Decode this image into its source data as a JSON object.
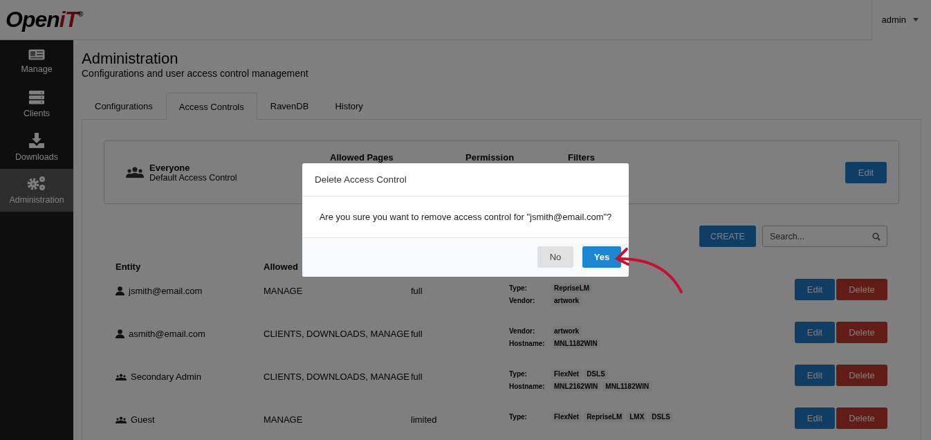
{
  "topbar": {
    "logo": {
      "word": "Open",
      "accent": "iT",
      "mark": "®"
    },
    "user_menu": {
      "label": "admin"
    }
  },
  "sidebar": {
    "items": [
      {
        "kind": "manage",
        "label": "Manage",
        "selected": false
      },
      {
        "kind": "clients",
        "label": "Clients",
        "selected": false
      },
      {
        "kind": "downloads",
        "label": "Downloads",
        "selected": false
      },
      {
        "kind": "admin",
        "label": "Administration",
        "selected": true
      }
    ]
  },
  "page": {
    "title": "Administration",
    "subtitle": "Configurations and user access control management"
  },
  "tabs": [
    {
      "label": "Configurations",
      "selected": false
    },
    {
      "label": "Access Controls",
      "selected": true
    },
    {
      "label": "RavenDB",
      "selected": false
    },
    {
      "label": "History",
      "selected": false
    }
  ],
  "default_card": {
    "name": "Everyone",
    "description": "Default Access Control",
    "columns": [
      "Allowed Pages",
      "Permission",
      "Filters"
    ],
    "edit_button": "Edit"
  },
  "toolbar": {
    "create_button": "CREATE",
    "search": {
      "placeholder": "Search..."
    }
  },
  "table": {
    "columns": [
      "Entity",
      "Allowed"
    ],
    "rows": [
      {
        "kind": "user",
        "entity": "jsmith@email.com",
        "pages": "MANAGE",
        "permission": "full",
        "filters": [
          {
            "label": "Type:",
            "values": [
              "RepriseLM"
            ]
          },
          {
            "label": "Vendor:",
            "values": [
              "artwork"
            ]
          }
        ],
        "edit": "Edit",
        "delete": "Delete"
      },
      {
        "kind": "user",
        "entity": "asmith@email.com",
        "pages": "CLIENTS, DOWNLOADS, MANAGE",
        "permission": "full",
        "filters": [
          {
            "label": "Vendor:",
            "values": [
              "artwork"
            ]
          },
          {
            "label": "Hostname:",
            "values": [
              "MNL1182WIN"
            ]
          }
        ],
        "edit": "Edit",
        "delete": "Delete"
      },
      {
        "kind": "group",
        "entity": "Secondary Admin",
        "pages": "CLIENTS, DOWNLOADS, MANAGE",
        "permission": "full",
        "filters": [
          {
            "label": "Type:",
            "values": [
              "FlexNet",
              "DSLS"
            ]
          },
          {
            "label": "Hostname:",
            "values": [
              "MNL2162WIN",
              "MNL1182WIN"
            ]
          }
        ],
        "edit": "Edit",
        "delete": "Delete"
      },
      {
        "kind": "group",
        "entity": "Guest",
        "pages": "MANAGE",
        "permission": "limited",
        "filters": [
          {
            "label": "Type:",
            "values": [
              "FlexNet",
              "RepriseLM",
              "LMX",
              "DSLS"
            ]
          }
        ],
        "edit": "Edit",
        "delete": "Delete"
      }
    ]
  },
  "modal": {
    "title": "Delete Access Control",
    "message": "Are you sure you want to remove access control for \"jsmith@email.com\"?",
    "buttons": [
      {
        "kind": "secondary",
        "label": "No"
      },
      {
        "kind": "primary",
        "label": "Yes"
      }
    ]
  }
}
